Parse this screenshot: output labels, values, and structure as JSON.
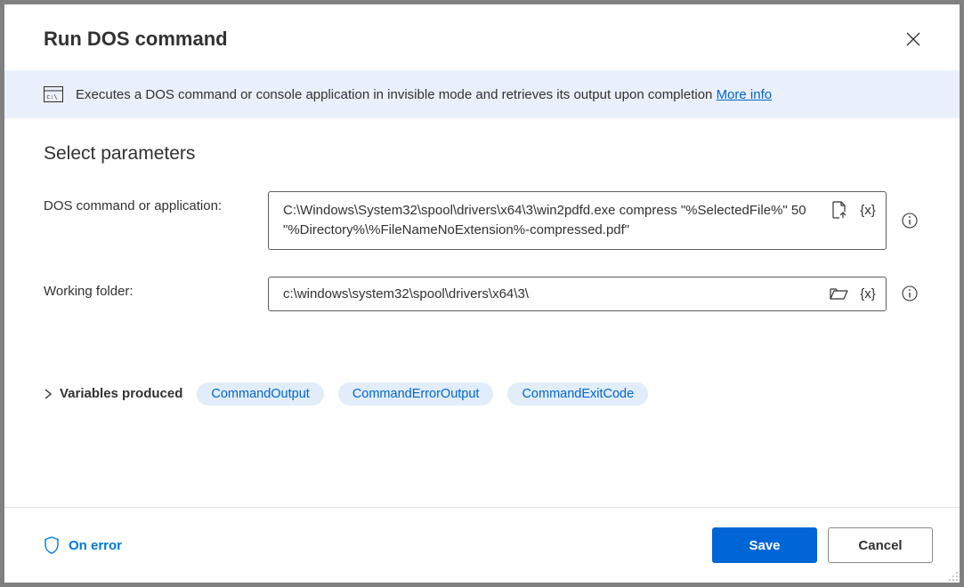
{
  "dialog": {
    "title": "Run DOS command"
  },
  "banner": {
    "text": "Executes a DOS command or console application in invisible mode and retrieves its output upon completion ",
    "link": "More info"
  },
  "section": {
    "title": "Select parameters"
  },
  "params": {
    "command": {
      "label": "DOS command or application:",
      "value": "C:\\Windows\\System32\\spool\\drivers\\x64\\3\\win2pdfd.exe compress \"%SelectedFile%\" 50 \"%Directory%\\%FileNameNoExtension%-compressed.pdf\""
    },
    "folder": {
      "label": "Working folder:",
      "value": "c:\\windows\\system32\\spool\\drivers\\x64\\3\\"
    }
  },
  "variables": {
    "label": "Variables produced",
    "items": [
      "CommandOutput",
      "CommandErrorOutput",
      "CommandExitCode"
    ]
  },
  "footer": {
    "onError": "On error",
    "save": "Save",
    "cancel": "Cancel"
  },
  "icons": {
    "varToken": "{x}"
  }
}
